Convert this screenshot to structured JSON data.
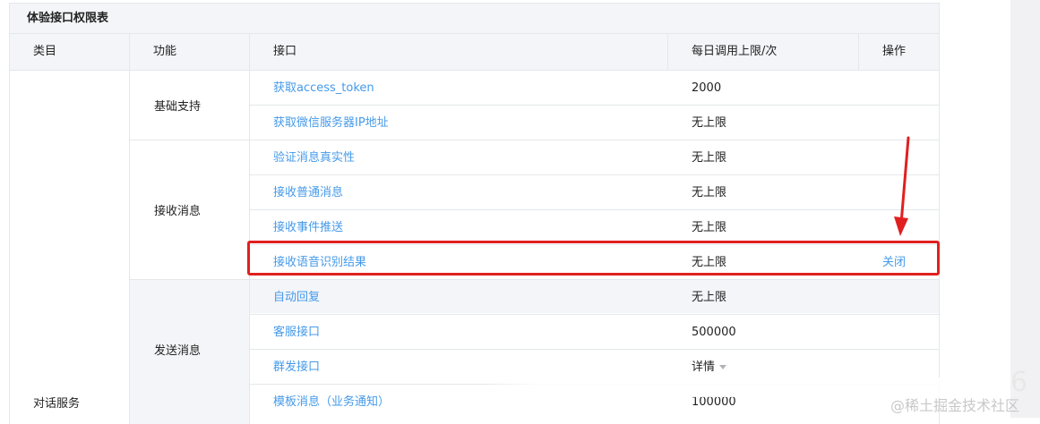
{
  "panel": {
    "title": "体验接口权限表"
  },
  "columns": {
    "category": "类目",
    "feature": "功能",
    "interface": "接口",
    "daily_limit": "每日调用上限/次",
    "action": "操作"
  },
  "category_label": "对话服务",
  "groups": [
    {
      "feature": "基础支持"
    },
    {
      "feature": "接收消息"
    },
    {
      "feature": "发送消息"
    }
  ],
  "rows": [
    {
      "interface": "获取access_token",
      "limit": "2000",
      "action": ""
    },
    {
      "interface": "获取微信服务器IP地址",
      "limit": "无上限",
      "action": ""
    },
    {
      "interface": "验证消息真实性",
      "limit": "无上限",
      "action": ""
    },
    {
      "interface": "接收普通消息",
      "limit": "无上限",
      "action": ""
    },
    {
      "interface": "接收事件推送",
      "limit": "无上限",
      "action": ""
    },
    {
      "interface": "接收语音识别结果",
      "limit": "无上限",
      "action": "关闭"
    },
    {
      "interface": "自动回复",
      "limit": "无上限",
      "action": ""
    },
    {
      "interface": "客服接口",
      "limit": "500000",
      "action": ""
    },
    {
      "interface": "群发接口",
      "limit": "详情",
      "action": ""
    },
    {
      "interface": "模板消息（业务通知）",
      "limit": "100000",
      "action": ""
    }
  ],
  "watermark": "@稀土掘金技术社区",
  "corner_digit": "6",
  "colors": {
    "link": "#459ae9",
    "header_bg": "#f4f5f9",
    "border": "#e4e8eb",
    "annotation": "#e02020"
  }
}
